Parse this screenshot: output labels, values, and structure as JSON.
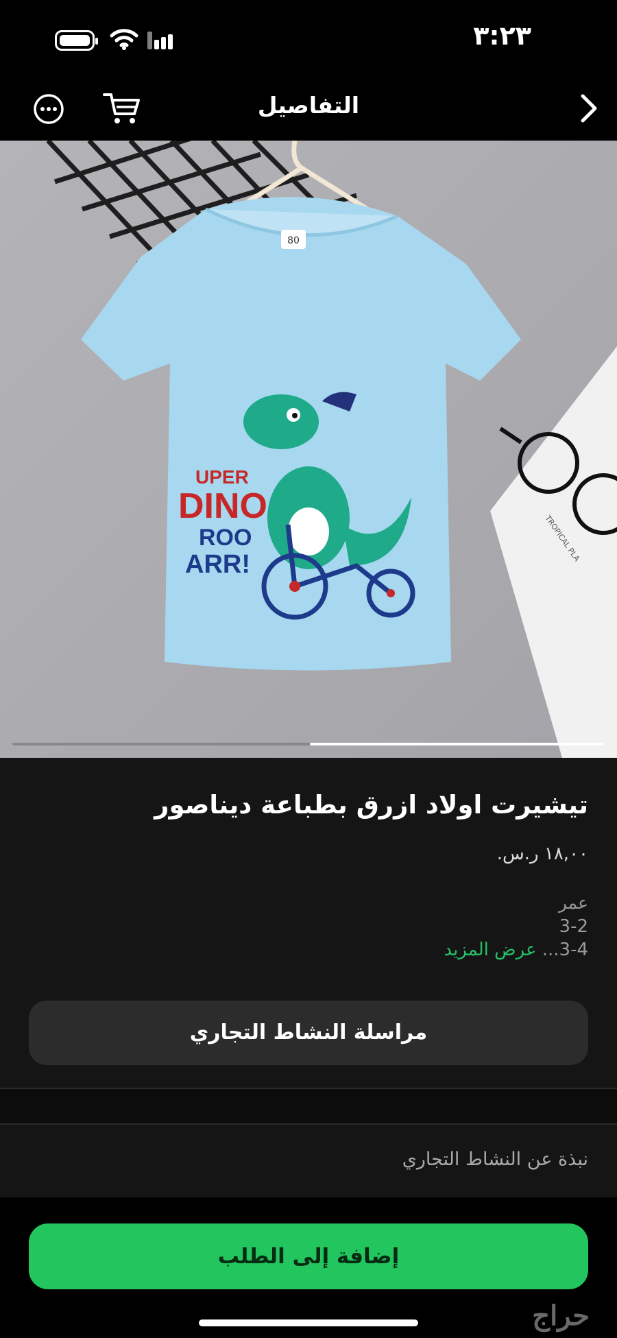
{
  "status_bar": {
    "time": "٣:٢٣"
  },
  "nav": {
    "title": "التفاصيل"
  },
  "product": {
    "title": "تيشيرت اولاد ازرق بطباعة ديناصور",
    "price": "١٨,٠٠ ر.س.",
    "attribute_label": "عمر",
    "attribute_value_1": "3-2",
    "attribute_value_2": "3-4...",
    "show_more": "عرض المزيد",
    "image": {
      "size_tag": "80",
      "print_line_1": "UPER",
      "print_line_2": "DINO",
      "print_line_3": "ROO",
      "print_line_4": "ARR!",
      "paper_text": "TROPICAL PLA"
    },
    "carousel": {
      "active_index": 2,
      "total": 2
    }
  },
  "actions": {
    "contact_business": "مراسلة النشاط التجاري",
    "about_business": "نبذة عن النشاط التجاري",
    "add_to_order": "إضافة إلى الطلب"
  },
  "branding": {
    "logo_text": "حراج"
  },
  "colors": {
    "accent": "#22c55e",
    "background": "#151515",
    "shirt": "#a7d8f0"
  }
}
